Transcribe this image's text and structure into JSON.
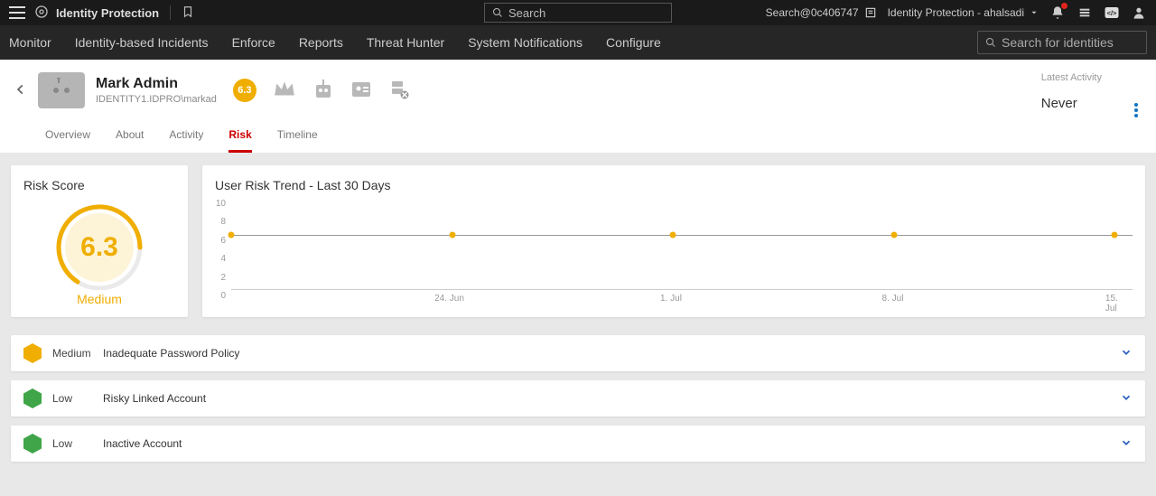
{
  "header": {
    "brand": "Identity Protection",
    "search_placeholder": "Search",
    "search_user": "Search@0c406747",
    "workspace": "Identity Protection - ahalsadi"
  },
  "nav": {
    "items": [
      "Monitor",
      "Identity-based Incidents",
      "Enforce",
      "Reports",
      "Threat Hunter",
      "System Notifications",
      "Configure"
    ],
    "identity_search_placeholder": "Search for identities"
  },
  "profile": {
    "name": "Mark Admin",
    "path": "IDENTITY1.IDPRO\\markad",
    "score_badge": "6.3",
    "latest_activity_label": "Latest Activity",
    "latest_activity_value": "Never",
    "tabs": [
      "Overview",
      "About",
      "Activity",
      "Risk",
      "Timeline"
    ],
    "active_tab": "Risk"
  },
  "risk_score": {
    "title": "Risk Score",
    "value": "6.3",
    "level": "Medium"
  },
  "trend_title": "User Risk Trend - Last 30 Days",
  "chart_data": {
    "type": "line",
    "title": "User Risk Trend - Last 30 Days",
    "xlabel": "",
    "ylabel": "",
    "ylim": [
      0,
      10
    ],
    "yticks": [
      0,
      2,
      4,
      6,
      8,
      10
    ],
    "categories": [
      "24. Jun",
      "1. Jul",
      "8. Jul",
      "15. Jul"
    ],
    "x_positions_pct": [
      0,
      24.5,
      49,
      73.5,
      98
    ],
    "x_tick_positions_pct": [
      24.5,
      49,
      73.5,
      98
    ],
    "values": [
      6.3,
      6.3,
      6.3,
      6.3,
      6.3
    ]
  },
  "risks": [
    {
      "severity": "Medium",
      "class": "medium",
      "name": "Inadequate Password Policy"
    },
    {
      "severity": "Low",
      "class": "low",
      "name": "Risky Linked Account"
    },
    {
      "severity": "Low",
      "class": "low",
      "name": "Inactive Account"
    }
  ]
}
